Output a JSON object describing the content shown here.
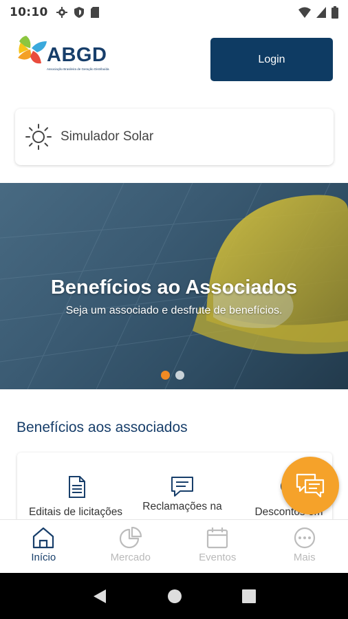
{
  "status_bar": {
    "time": "10:10"
  },
  "header": {
    "logo_text": "ABGD",
    "logo_subtitle": "Associação Brasileira de Geração Distribuída",
    "login_label": "Login"
  },
  "simulator": {
    "label": "Simulador Solar",
    "icon": "sun-icon"
  },
  "banner": {
    "title": "Benefícios ao Associados",
    "subtitle": "Seja um associado e desfrute de benefícios.",
    "slide_count": 2,
    "active_slide": 1
  },
  "section": {
    "title": "Benefícios aos associados",
    "items": [
      {
        "label": "Editais de licitações",
        "icon": "document-icon"
      },
      {
        "label": "Reclamações na",
        "icon": "chat-icon"
      },
      {
        "label": "Descontos em",
        "icon": "gear-icon"
      }
    ]
  },
  "bottom_nav": {
    "items": [
      {
        "label": "Início",
        "icon": "home-icon",
        "active": true
      },
      {
        "label": "Mercado",
        "icon": "pie-chart-icon",
        "active": false
      },
      {
        "label": "Eventos",
        "icon": "calendar-icon",
        "active": false
      },
      {
        "label": "Mais",
        "icon": "more-icon",
        "active": false
      }
    ]
  },
  "colors": {
    "primary": "#0e3b63",
    "accent": "#f5a22a",
    "dot_active": "#f08a24"
  }
}
